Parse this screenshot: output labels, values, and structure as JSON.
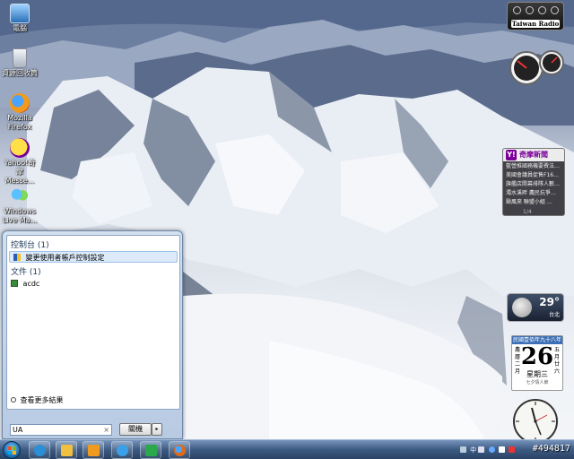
{
  "desktop": {
    "icons": [
      {
        "label": "電腦",
        "icon": "computer-icon"
      },
      {
        "label": "資源回收筒",
        "icon": "recycle-bin-icon"
      },
      {
        "label": "Mozilla Firefox",
        "icon": "firefox-icon"
      },
      {
        "label": "Yahoo!奇摩 Messe...",
        "icon": "yahoo-messenger-icon"
      },
      {
        "label": "Windows Live Ma...",
        "icon": "windows-live-mail-icon"
      }
    ]
  },
  "gadgets": {
    "radio": {
      "name": "Taiwan Radio"
    },
    "news": {
      "brand": "Y!",
      "headline": "奇摩新聞",
      "items": [
        "藍營推國務機要費法…",
        "美國會議員促售F16…",
        "旗艦店開幕排隊人數…",
        "濁水溪畔 農民抗爭…",
        "颱風來 聯盟小組 …"
      ],
      "pager": "1/4"
    },
    "weather": {
      "temp": "29°",
      "city": "台北"
    },
    "calendar": {
      "top": "民國壹佰年九十八年",
      "day": "26",
      "left_text": "農曆二月",
      "right_text": "五月廿六",
      "weekday": "星期三",
      "bottom": "七夕情人節"
    }
  },
  "start_menu": {
    "groups": [
      {
        "title": "控制台 (1)",
        "items": [
          {
            "label": "變更使用者帳戶控制設定",
            "selected": true
          }
        ]
      },
      {
        "title": "文件 (1)",
        "items": [
          {
            "label": "acdc",
            "selected": false
          }
        ]
      }
    ],
    "see_more": "查看更多結果",
    "search_value": "UA",
    "search_clear": "×",
    "shutdown_label": "關機",
    "shutdown_arrow": "▸"
  },
  "taskbar": {
    "pinned": [
      {
        "name": "ie",
        "icon": "internet-explorer-icon",
        "color": "#2a8fd6"
      },
      {
        "name": "explorer",
        "icon": "folder-icon",
        "color": "#f0c040"
      },
      {
        "name": "media-player",
        "icon": "media-player-icon",
        "color": "#f09a20"
      },
      {
        "name": "app-blue",
        "icon": "messenger-icon",
        "color": "#3aa0e8"
      },
      {
        "name": "app-green",
        "icon": "app-green-icon",
        "color": "#2aa84a"
      },
      {
        "name": "firefox",
        "icon": "firefox-icon",
        "color": "#e06a1a"
      }
    ],
    "tray_text": "中",
    "watermark": "#494817"
  }
}
